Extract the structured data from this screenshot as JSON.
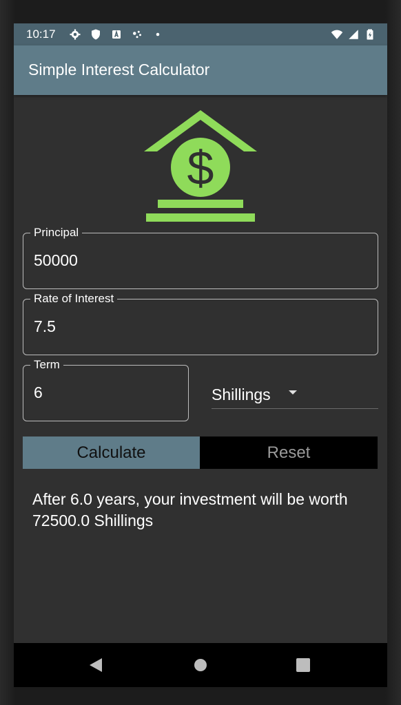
{
  "status_bar": {
    "time": "10:17",
    "left_icons": [
      "settings-icon",
      "shield-icon",
      "a-icon",
      "dots-icon",
      "dot-icon"
    ],
    "right_icons": [
      "wifi-icon",
      "signal-icon",
      "battery-icon"
    ]
  },
  "app_bar": {
    "title": "Simple Interest Calculator"
  },
  "logo": {
    "icon": "house-dollar-icon",
    "color": "#8fdb5a"
  },
  "form": {
    "principal": {
      "label": "Principal",
      "value": "50000"
    },
    "rate": {
      "label": "Rate of Interest",
      "value": "7.5"
    },
    "term": {
      "label": "Term",
      "value": "6"
    },
    "currency": {
      "selected": "Shillings"
    }
  },
  "buttons": {
    "calculate": "Calculate",
    "reset": "Reset"
  },
  "result": {
    "text": "After 6.0 years, your investment will be worth 72500.0 Shillings"
  },
  "colors": {
    "primary": "#5f7c89",
    "accent": "#8fdb5a",
    "background": "#303030"
  }
}
